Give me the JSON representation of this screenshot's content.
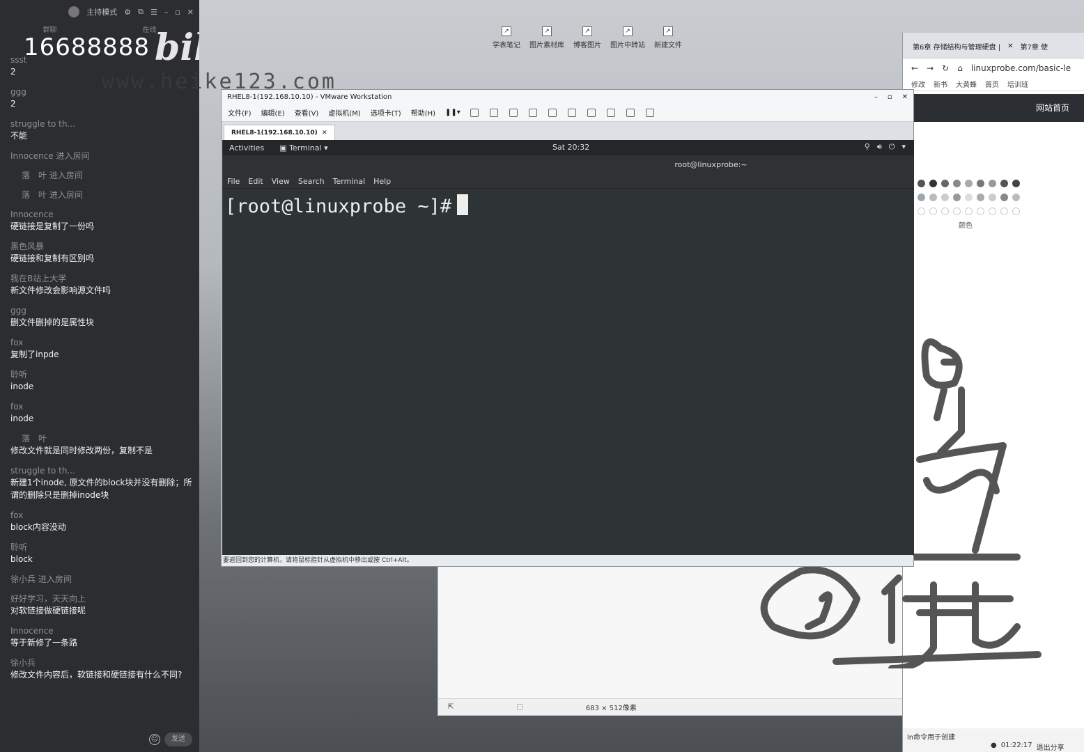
{
  "desktop": {
    "icons": [
      {
        "label": "学表笔记"
      },
      {
        "label": "图片素材库"
      },
      {
        "label": "博客图片"
      },
      {
        "label": "图片中转站"
      },
      {
        "label": "新建文件"
      }
    ]
  },
  "chat": {
    "mode_label": "主持模式",
    "tabs": [
      "群聊",
      "在线"
    ],
    "overlay_number": "16688888",
    "overlay_logo": "bilibili",
    "overlay_url": "www.heike123.com",
    "messages": [
      {
        "user": "ssst",
        "text": "2"
      },
      {
        "user": "ggg",
        "text": "2"
      },
      {
        "user": "struggle to th...",
        "text": "不能"
      },
      {
        "user": "Innocence 进入房间",
        "text": ""
      },
      {
        "user": "落　叶 进入房间",
        "text": ""
      },
      {
        "user": "落　叶 进入房间",
        "text": ""
      },
      {
        "user": "Innocence",
        "text": "硬链接是复制了一份吗"
      },
      {
        "user": "黑色风暴",
        "text": "硬链接和复制有区别吗"
      },
      {
        "user": "我在B站上大学",
        "text": "新文件修改会影响源文件吗"
      },
      {
        "user": "ggg",
        "text": "删文件删掉的是属性块"
      },
      {
        "user": "fox",
        "text": "复制了inpde"
      },
      {
        "user": "聆听",
        "text": "inode"
      },
      {
        "user": "fox",
        "text": "inode"
      },
      {
        "user": "落　叶",
        "text": "修改文件就是同时修改两份，复制不是"
      },
      {
        "user": "struggle to th...",
        "text": "新建1个inode, 原文件的block块并没有删除；所谓的删除只是删掉inode块"
      },
      {
        "user": "fox",
        "text": "block内容没动"
      },
      {
        "user": "聆听",
        "text": "block"
      },
      {
        "user": "徐小兵 进入房间",
        "text": ""
      },
      {
        "user": "好好学习，天天向上",
        "text": "对软链接做硬链接呢"
      },
      {
        "user": "Innocence",
        "text": "等于新修了一条路"
      },
      {
        "user": "徐小兵",
        "text": "修改文件内容后，软链接和硬链接有什么不同?"
      }
    ],
    "send_label": "发送"
  },
  "browser": {
    "tabs": [
      "第6章 存储结构与管理硬盘 |",
      "第7章 使"
    ],
    "url": "linuxprobe.com/basic-le",
    "bookmarks": [
      "修改",
      "新书",
      "大黄蜂",
      "首页",
      "培训班"
    ],
    "nav_label": "网站首页",
    "palette_label": "颜色",
    "status_left": "ln命令用于创建",
    "timer": "01:22:17",
    "exit_share": "退出分享"
  },
  "paint": {
    "size_label": "683 × 512像素"
  },
  "vmware": {
    "title": "RHEL8-1(192.168.10.10) - VMware Workstation",
    "menus": [
      "文件(F)",
      "编辑(E)",
      "查看(V)",
      "虚拟机(M)",
      "选项卡(T)",
      "帮助(H)"
    ],
    "tab_label": "RHEL8-1(192.168.10.10)",
    "status_text": "要返回到您的计算机，请将鼠标指针从虚拟机中移出或按 Ctrl+Alt。",
    "gnome": {
      "activities": "Activities",
      "app": "Terminal",
      "clock": "Sat 20:32"
    },
    "terminal": {
      "title": "root@linuxprobe:~",
      "menus": [
        "File",
        "Edit",
        "View",
        "Search",
        "Terminal",
        "Help"
      ],
      "prompt": "[root@linuxprobe ~]#"
    }
  },
  "colors": {
    "chat_bg": "#2b2d30",
    "terminal_bg": "#2e3436",
    "terminal_fg": "#eeeeec"
  }
}
